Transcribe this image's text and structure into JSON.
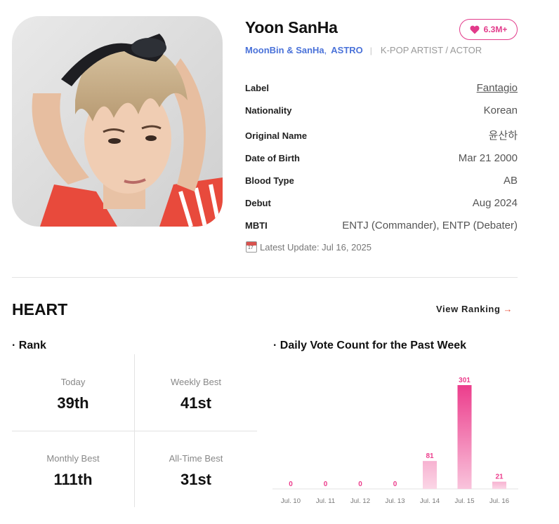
{
  "artist": {
    "name": "Yoon SanHa",
    "likes": "6.3M+",
    "groups": [
      "MoonBin & SanHa",
      "ASTRO"
    ],
    "role": "K-POP ARTIST / ACTOR"
  },
  "info": [
    {
      "key": "Label",
      "value": "Fantagio"
    },
    {
      "key": "Nationality",
      "value": "Korean"
    },
    {
      "key": "Original Name",
      "value": "윤산하"
    },
    {
      "key": "Date of Birth",
      "value": "Mar 21 2000"
    },
    {
      "key": "Blood Type",
      "value": "AB"
    },
    {
      "key": "Debut",
      "value": "Aug 2024"
    },
    {
      "key": "MBTI",
      "value": "ENTJ (Commander), ENTP (Debater)"
    }
  ],
  "latest_update": "Latest Update: Jul 16, 2025",
  "heart": {
    "title": "HEART",
    "view_ranking": "View Ranking",
    "rank_title": "· Rank",
    "chart_title": "· Daily Vote Count for the Past Week",
    "ranks": [
      {
        "label": "Today",
        "value": "39th"
      },
      {
        "label": "Weekly Best",
        "value": "41st"
      },
      {
        "label": "Monthly Best",
        "value": "111th"
      },
      {
        "label": "All-Time Best",
        "value": "31st"
      }
    ]
  },
  "colors": {
    "accent": "#e23a8a",
    "link": "#4a72d9",
    "bar_strong": "#ec3d8c",
    "bar_light": "#f9c4dc"
  },
  "chart_data": {
    "type": "bar",
    "categories": [
      "Jul. 10",
      "Jul. 11",
      "Jul. 12",
      "Jul. 13",
      "Jul. 14",
      "Jul. 15",
      "Jul. 16"
    ],
    "values": [
      0,
      0,
      0,
      0,
      81,
      301,
      21
    ],
    "ylim": [
      0,
      301
    ],
    "grid": false
  }
}
